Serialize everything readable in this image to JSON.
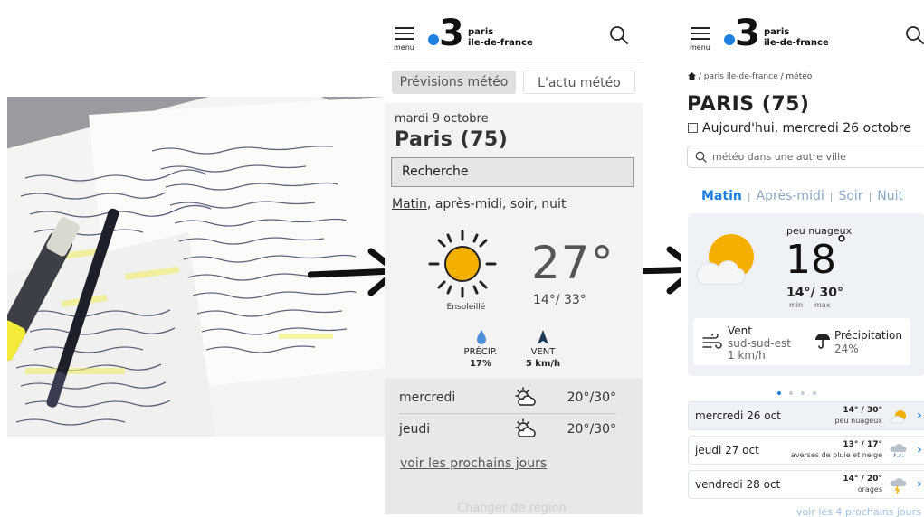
{
  "header": {
    "menu_label": "menu",
    "logo_number": "3",
    "logo_line1": "paris",
    "logo_line2": "ile-de-france"
  },
  "old_version": {
    "tabs": [
      "Prévisions météo",
      "L'actu météo"
    ],
    "date": "mardi 9 octobre",
    "city": "Paris (75)",
    "search_label": "Recherche",
    "period_first": "Matin",
    "period_rest": ", après-midi, soir, nuit",
    "temperature": "27°",
    "condition": "Ensoleillé",
    "min_max": "14°/ 33°",
    "precip_label": "PRÉCIP.",
    "precip_value": "17%",
    "wind_label": "VENT",
    "wind_value": "5 km/h",
    "days": [
      {
        "name": "mercredi",
        "temps": "20°/30°"
      },
      {
        "name": "jeudi",
        "temps": "20°/30°"
      }
    ],
    "more_days": "voir les prochains jours",
    "change_region": "Changer de région"
  },
  "new_version": {
    "breadcrumb_link": "paris ile-de-france",
    "breadcrumb_current": "météo",
    "city": "PARIS (75)",
    "date": "Aujourd'hui, mercredi 26 octobre",
    "search_placeholder": "météo dans une autre ville",
    "periods": [
      "Matin",
      "Après-midi",
      "Soir",
      "Nuit"
    ],
    "period_sep": "|",
    "condition": "peu nuageux",
    "temperature": "18",
    "degree": "°",
    "min_max": "14°/ 30°",
    "min_label": "min",
    "max_label": "max",
    "wind_title": "Vent",
    "wind_direction": "sud-sud-est",
    "wind_speed": "1 km/h",
    "precip_title": "Précipitation",
    "precip_value": "24%",
    "carousel_dots": 4,
    "carousel_active": 0,
    "forecast": [
      {
        "day": "mercredi 26 oct",
        "temps": "14° / 30°",
        "condition": "peu nuageux",
        "icon": "sun-cloud-icon"
      },
      {
        "day": "jeudi 27 oct",
        "temps": "13° / 17°",
        "condition": "averses de pluie et neige",
        "icon": "rain-snow-icon"
      },
      {
        "day": "vendredi 28 oct",
        "temps": "14° / 20°",
        "condition": "orages",
        "icon": "storm-icon"
      }
    ],
    "chevron": "›",
    "more_days": "voir les 4 prochains jours"
  },
  "colors": {
    "brand_blue": "#1f7fe0",
    "sun_yellow": "#f4b000",
    "card_bg": "#eef2f6"
  }
}
